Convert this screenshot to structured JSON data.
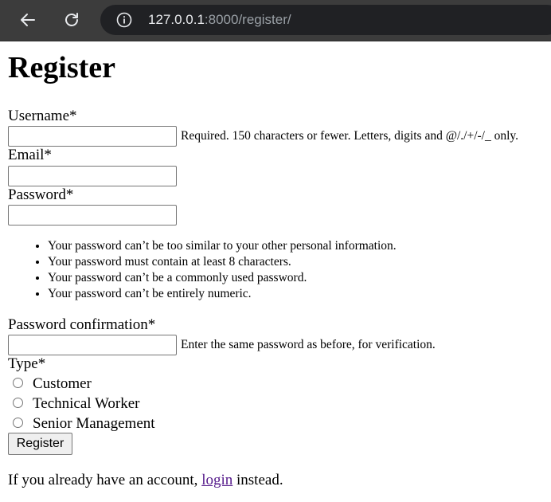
{
  "browser": {
    "url_host": "127.0.0.1",
    "url_path": ":8000/register/"
  },
  "page": {
    "title": "Register"
  },
  "form": {
    "username_label": "Username*",
    "username_value": "",
    "username_help": "Required. 150 characters or fewer. Letters, digits and @/./+/-/_ only.",
    "email_label": "Email*",
    "email_value": "",
    "password_label": "Password*",
    "password_value": "",
    "password_rules": [
      "Your password can’t be too similar to your other personal information.",
      "Your password must contain at least 8 characters.",
      "Your password can’t be a commonly used password.",
      "Your password can’t be entirely numeric."
    ],
    "password_confirm_label": "Password confirmation*",
    "password_confirm_value": "",
    "password_confirm_help": "Enter the same password as before, for verification.",
    "type_label": "Type*",
    "type_options": [
      "Customer",
      "Technical Worker",
      "Senior Management"
    ],
    "submit_label": "Register"
  },
  "footer": {
    "prefix": "If you already have an account, ",
    "link_text": "login",
    "suffix": " instead."
  },
  "colors": {
    "chrome_bg": "#3c3c3c",
    "address_bg": "#202124",
    "link_visited": "#551a8b"
  }
}
